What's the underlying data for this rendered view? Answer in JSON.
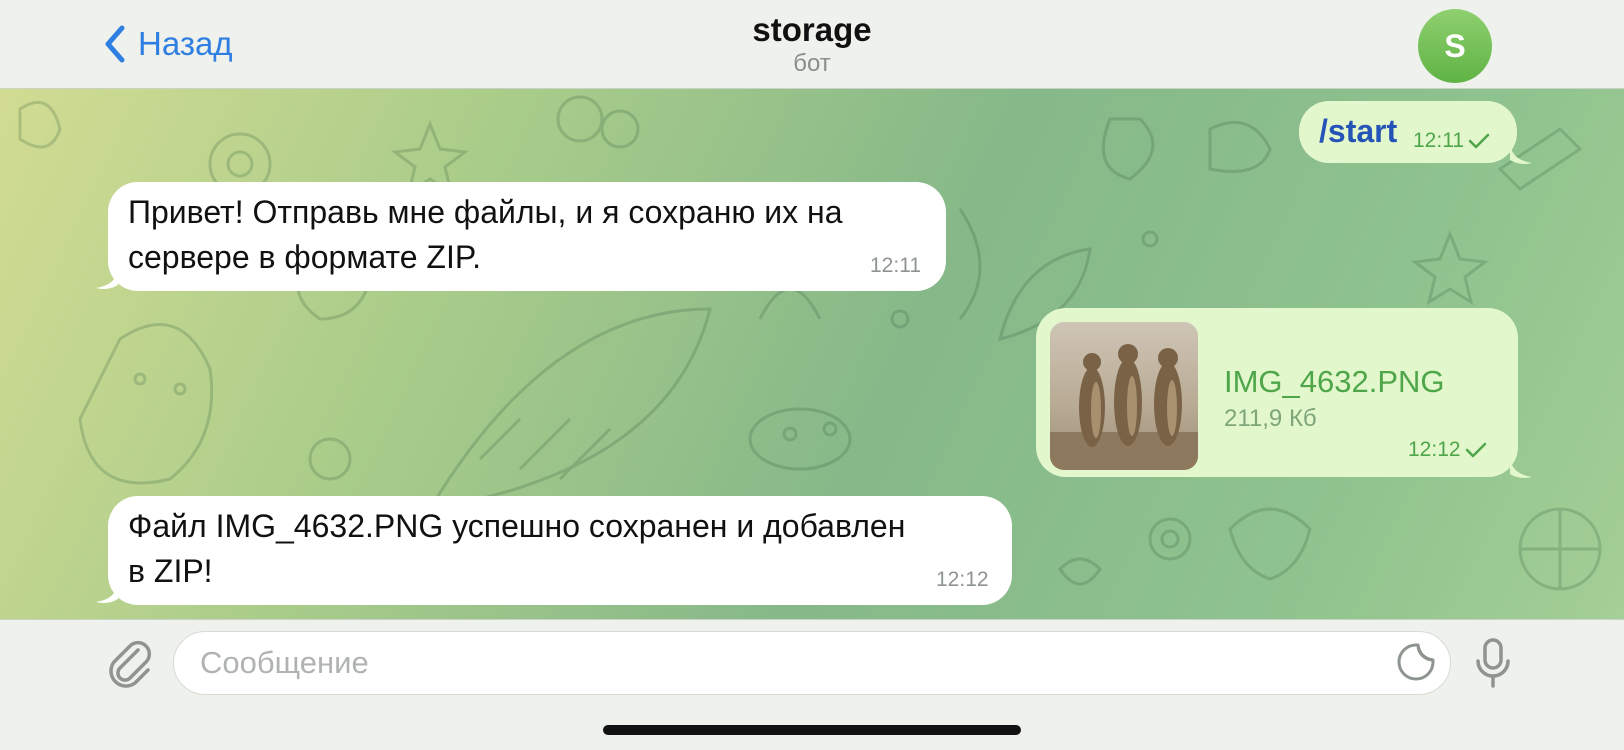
{
  "header": {
    "back_label": "Назад",
    "title": "storage",
    "subtitle": "бот",
    "avatar_letter": "S",
    "accent_color": "#2f7fe3"
  },
  "messages": [
    {
      "direction": "outgoing",
      "text": "/start",
      "time": "12:11",
      "status": "sent"
    },
    {
      "direction": "incoming",
      "lines": [
        "Привет! Отправь мне файлы, и я сохраню их на",
        "сервере в формате ZIP."
      ],
      "time": "12:11"
    },
    {
      "direction": "outgoing",
      "type": "file",
      "file_name": "IMG_4632.PNG",
      "file_size": "211,9 Кб",
      "time": "12:12",
      "status": "sent"
    },
    {
      "direction": "incoming",
      "lines": [
        "Файл IMG_4632.PNG успешно сохранен и добавлен",
        "в ZIP!"
      ],
      "time": "12:12"
    }
  ],
  "composer": {
    "placeholder": "Сообщение",
    "attach_icon": "paperclip-icon",
    "sticker_icon": "sticker-icon",
    "mic_icon": "microphone-icon"
  },
  "colors": {
    "incoming_bubble": "#ffffff",
    "outgoing_bubble": "#e2f7cb",
    "outgoing_accent": "#4fa64a",
    "command_color": "#2554b8"
  }
}
